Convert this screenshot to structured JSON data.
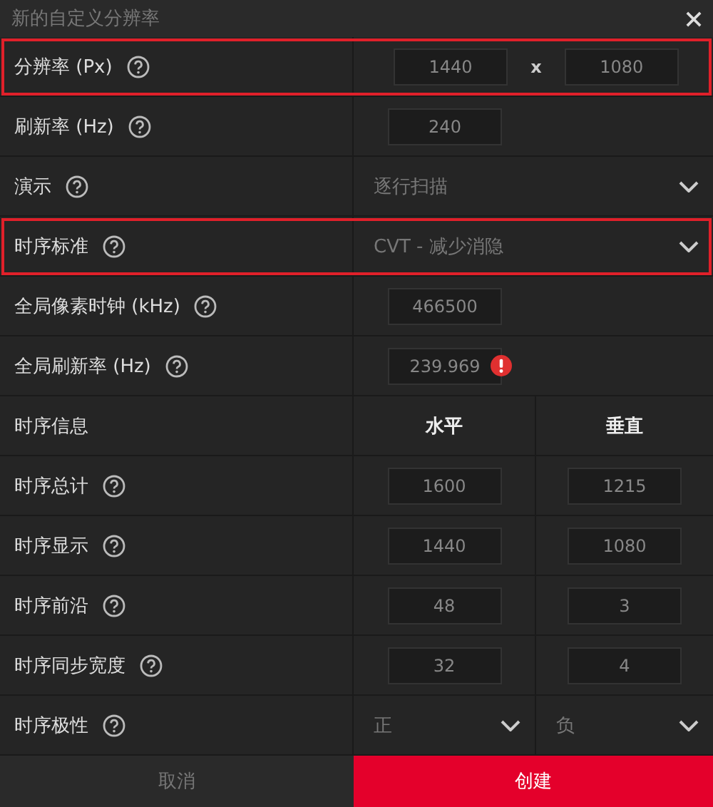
{
  "window": {
    "title": "新的自定义分辨率"
  },
  "rows": [
    {
      "kind": "pair",
      "label": "分辨率 (Px)",
      "help": true,
      "highlighted": true,
      "values": [
        "1440",
        "1080"
      ],
      "separator": "x"
    },
    {
      "kind": "input",
      "label": "刷新率 (Hz)",
      "help": true,
      "highlighted": false,
      "values": [
        "240"
      ],
      "warning": false
    },
    {
      "kind": "select",
      "label": "演示",
      "help": true,
      "highlighted": false,
      "value": "逐行扫描"
    },
    {
      "kind": "select",
      "label": "时序标准",
      "help": true,
      "highlighted": true,
      "value": "CVT - 减少消隐"
    },
    {
      "kind": "input",
      "label": "全局像素时钟 (kHz)",
      "help": true,
      "highlighted": false,
      "values": [
        "466500"
      ],
      "warning": false
    },
    {
      "kind": "input",
      "label": "全局刷新率 (Hz)",
      "help": true,
      "highlighted": false,
      "values": [
        "239.969"
      ],
      "warning": true
    },
    {
      "kind": "header",
      "label": "时序信息",
      "help": false,
      "highlighted": false,
      "columns": [
        "水平",
        "垂直"
      ]
    },
    {
      "kind": "hv",
      "label": "时序总计",
      "help": true,
      "highlighted": false,
      "values": [
        "1600",
        "1215"
      ]
    },
    {
      "kind": "hv",
      "label": "时序显示",
      "help": true,
      "highlighted": false,
      "values": [
        "1440",
        "1080"
      ]
    },
    {
      "kind": "hv",
      "label": "时序前沿",
      "help": true,
      "highlighted": false,
      "values": [
        "48",
        "3"
      ]
    },
    {
      "kind": "hv",
      "label": "时序同步宽度",
      "help": true,
      "highlighted": false,
      "values": [
        "32",
        "4"
      ]
    },
    {
      "kind": "selects",
      "label": "时序极性",
      "help": true,
      "highlighted": false,
      "values": [
        "正",
        "负"
      ]
    }
  ],
  "buttons": [
    {
      "label": "取消",
      "primary": false
    },
    {
      "label": "创建",
      "primary": true
    }
  ]
}
